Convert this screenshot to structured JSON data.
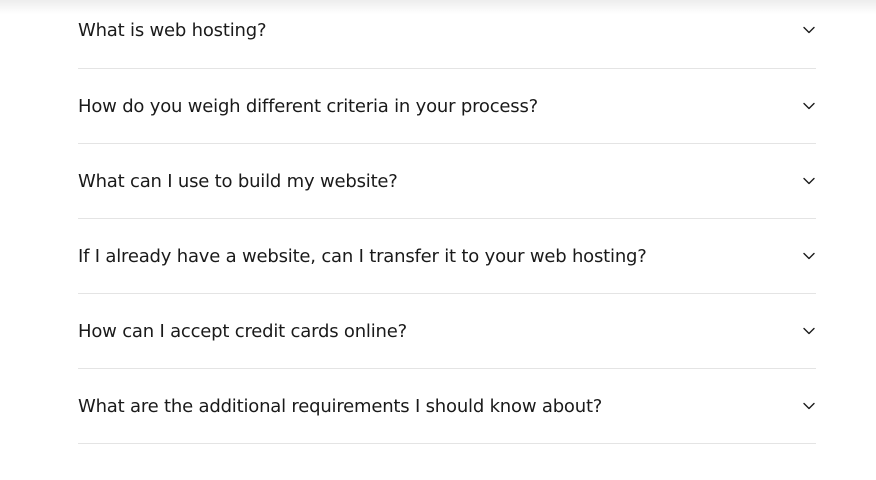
{
  "faq": {
    "items": [
      {
        "question": "What is web hosting?"
      },
      {
        "question": "How do you weigh different criteria in your process?"
      },
      {
        "question": "What can I use to build my website?"
      },
      {
        "question": "If I already have a website, can I transfer it to your web hosting?"
      },
      {
        "question": "How can I accept credit cards online?"
      },
      {
        "question": "What are the additional requirements I should know about?"
      }
    ],
    "expand_icon": "chevron-down-icon"
  },
  "colors": {
    "text": "#1a1a1a",
    "divider": "#e4e4e4",
    "background": "#ffffff"
  }
}
